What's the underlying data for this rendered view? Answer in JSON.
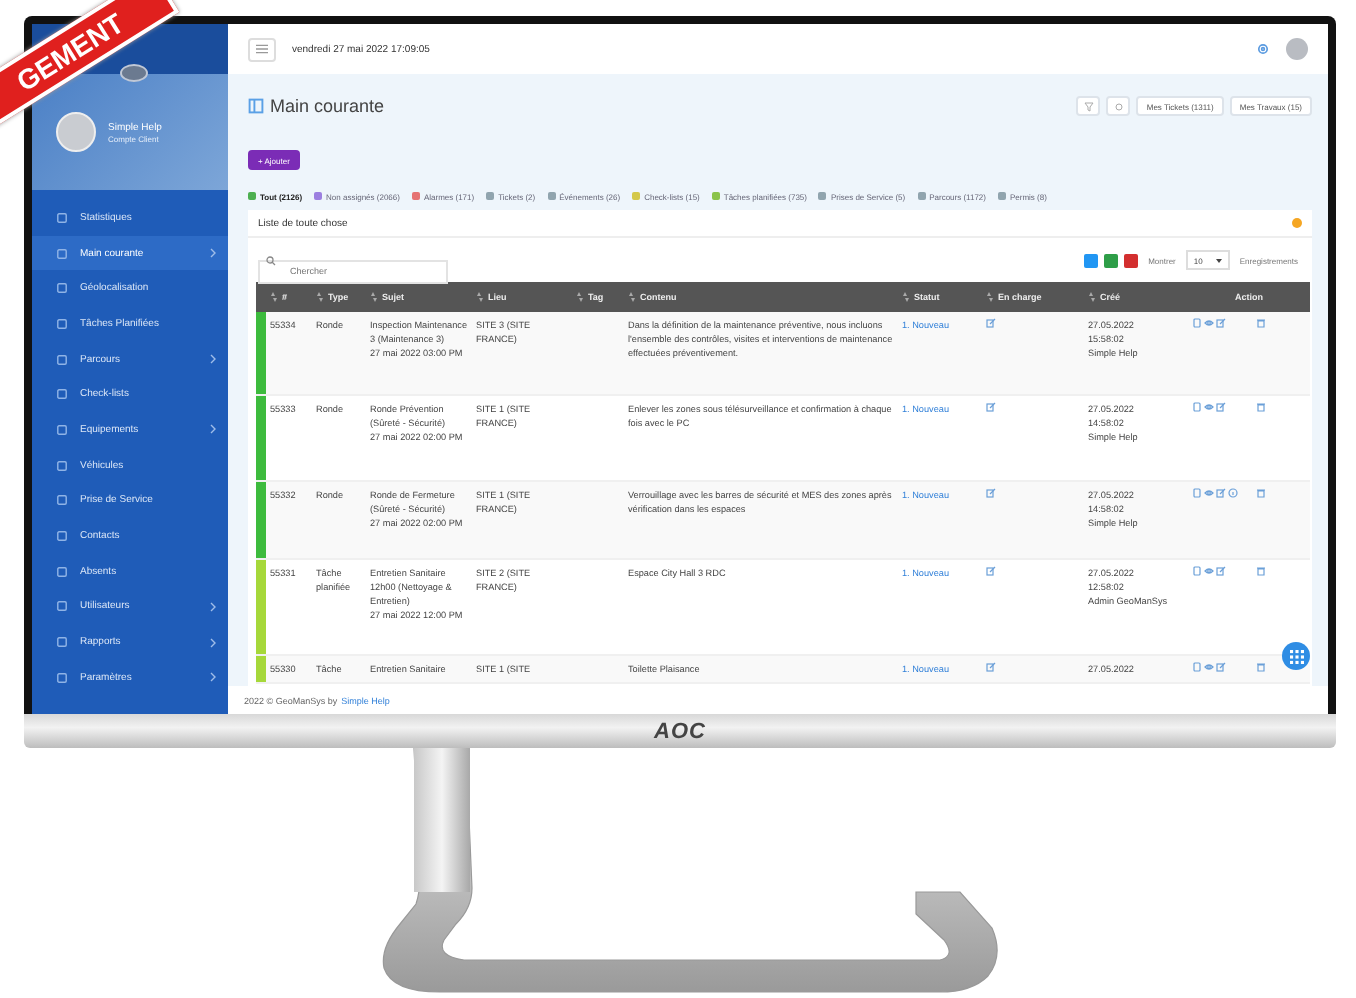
{
  "badge": {
    "text": "GEMENT"
  },
  "sidebar": {
    "user": {
      "name": "Simple Help",
      "role": "Compte Client"
    },
    "items": [
      {
        "label": "Statistiques",
        "selected": false,
        "expandable": false
      },
      {
        "label": "Main courante",
        "selected": true,
        "expandable": true
      },
      {
        "label": "Géolocalisation",
        "selected": false,
        "expandable": false
      },
      {
        "label": "Tâches Planifiées",
        "selected": false,
        "expandable": false
      },
      {
        "label": "Parcours",
        "selected": false,
        "expandable": true
      },
      {
        "label": "Check-lists",
        "selected": false,
        "expandable": false
      },
      {
        "label": "Equipements",
        "selected": false,
        "expandable": true
      },
      {
        "label": "Véhicules",
        "selected": false,
        "expandable": false
      },
      {
        "label": "Prise de Service",
        "selected": false,
        "expandable": false
      },
      {
        "label": "Contacts",
        "selected": false,
        "expandable": false
      },
      {
        "label": "Absents",
        "selected": false,
        "expandable": false
      },
      {
        "label": "Utilisateurs",
        "selected": false,
        "expandable": true
      },
      {
        "label": "Rapports",
        "selected": false,
        "expandable": true
      },
      {
        "label": "Paramètres",
        "selected": false,
        "expandable": true
      }
    ]
  },
  "topbar": {
    "datetime": "vendredi 27 mai 2022 17:09:05"
  },
  "page": {
    "title": "Main courante",
    "header_buttons": [
      "Mes Tickets (1311)",
      "Mes Travaux (15)"
    ],
    "add_button": "+ Ajouter"
  },
  "filters": [
    {
      "label": "Tout (2126)",
      "selected": true,
      "color": "#4caf50"
    },
    {
      "label": "Non assignés (2066)",
      "selected": false,
      "color": "#9c7fe0"
    },
    {
      "label": "Alarmes (171)",
      "selected": false,
      "color": "#e57373"
    },
    {
      "label": "Tickets (2)",
      "selected": false,
      "color": "#90a4ae"
    },
    {
      "label": "Événements (26)",
      "selected": false,
      "color": "#90a4ae"
    },
    {
      "label": "Check-lists (15)",
      "selected": false,
      "color": "#d4c84a"
    },
    {
      "label": "Tâches planifiées (735)",
      "selected": false,
      "color": "#8bc34a"
    },
    {
      "label": "Prises de Service (5)",
      "selected": false,
      "color": "#90a4ae"
    },
    {
      "label": "Parcours (1172)",
      "selected": false,
      "color": "#90a4ae"
    },
    {
      "label": "Permis (8)",
      "selected": false,
      "color": "#90a4ae"
    }
  ],
  "card": {
    "title": "Liste de toute chose",
    "search": {
      "placeholder": "Chercher"
    },
    "export_buttons": [
      {
        "color": "#2196f3"
      },
      {
        "color": "#2e9e48"
      },
      {
        "color": "#d32f2f"
      }
    ],
    "show_label": "Montrer",
    "page_size": "10",
    "records_label": "Enregistrements"
  },
  "table": {
    "columns": [
      "#",
      "Type",
      "Sujet",
      "Lieu",
      "Tag",
      "Contenu",
      "Statut",
      "En charge",
      "Créé",
      "Action"
    ],
    "rows": [
      {
        "color": "#3dbb3d",
        "id": "55334",
        "type": "Ronde",
        "subject": "Inspection Maintenance 3 (Maintenance 3)",
        "date": "27 mai 2022 03:00 PM",
        "place": "SITE 3 (SITE FRANCE)",
        "content": "Dans la définition de la maintenance préventive, nous incluons l'ensemble des contrôles, visites et interventions de maintenance effectuées préventivement.",
        "status": "1. Nouveau",
        "created": [
          "27.05.2022",
          "15:58:02",
          "Simple Help"
        ],
        "actions": [
          {
            "kind": "copy"
          },
          {
            "kind": "view"
          },
          {
            "kind": "edit"
          }
        ]
      },
      {
        "color": "#3dbb3d",
        "id": "55333",
        "type": "Ronde",
        "subject": "Ronde Prévention (Sûreté - Sécurité)",
        "date": "27 mai 2022 02:00 PM",
        "place": "SITE 1 (SITE FRANCE)",
        "content": "Enlever les zones sous télésurveillance et confirmation à chaque fois avec le PC",
        "status": "1. Nouveau",
        "created": [
          "27.05.2022",
          "14:58:02",
          "Simple Help"
        ],
        "actions": [
          {
            "kind": "copy"
          },
          {
            "kind": "view"
          },
          {
            "kind": "edit"
          }
        ]
      },
      {
        "color": "#3dbb3d",
        "id": "55332",
        "type": "Ronde",
        "subject": "Ronde de Fermeture (Sûreté - Sécurité)",
        "date": "27 mai 2022 02:00 PM",
        "place": "SITE 1 (SITE FRANCE)",
        "content": "Verrouillage avec les barres de sécurité et MES des zones après vérification dans les espaces",
        "status": "1. Nouveau",
        "created": [
          "27.05.2022",
          "14:58:02",
          "Simple Help"
        ],
        "actions": [
          {
            "kind": "copy"
          },
          {
            "kind": "view"
          },
          {
            "kind": "edit"
          },
          {
            "kind": "info"
          }
        ]
      },
      {
        "color": "#a6d83a",
        "id": "55331",
        "type": "Tâche planifiée",
        "subject": "Entretien Sanitaire 12h00 (Nettoyage & Entretien)",
        "date": "27 mai 2022 12:00 PM",
        "place": "SITE 2 (SITE FRANCE)",
        "content": "Espace City Hall 3 RDC",
        "status": "1. Nouveau",
        "created": [
          "27.05.2022",
          "12:58:02",
          "Admin GeoManSys"
        ],
        "actions": [
          {
            "kind": "copy"
          },
          {
            "kind": "view"
          },
          {
            "kind": "edit"
          }
        ]
      },
      {
        "color": "#a6d83a",
        "id": "55330",
        "type": "Tâche",
        "subject": "Entretien Sanitaire",
        "place": "SITE 1 (SITE",
        "content": "Toilette Plaisance",
        "status": "1. Nouveau",
        "created": [
          "27.05.2022"
        ],
        "actions": [
          {
            "kind": "copy"
          },
          {
            "kind": "view"
          },
          {
            "kind": "edit"
          }
        ]
      }
    ]
  },
  "footer": {
    "text": "2022 © GeoManSys by",
    "link": "Simple Help"
  },
  "monitor": {
    "brand": "AOC"
  }
}
